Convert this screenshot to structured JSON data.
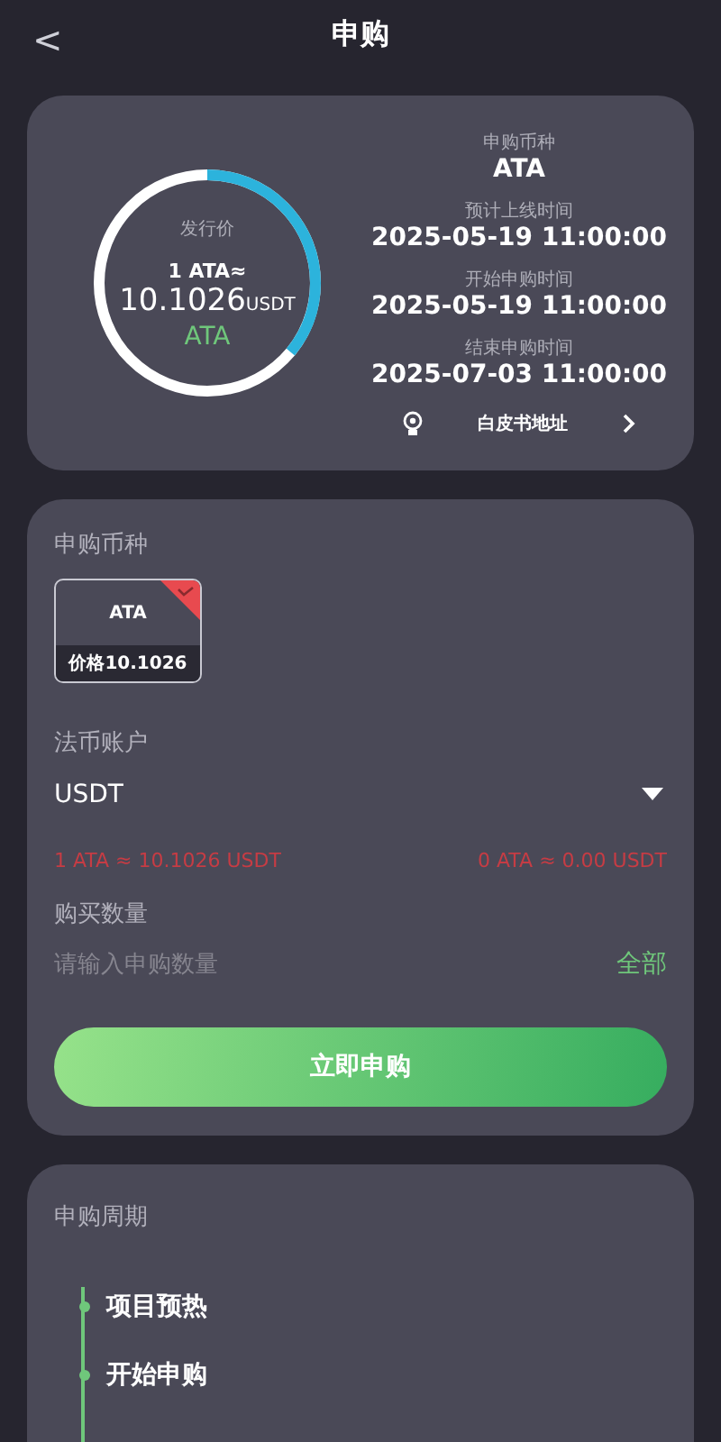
{
  "header": {
    "back": "<",
    "title": "申购"
  },
  "overview": {
    "ring_label": "发行价",
    "rate_line": "1 ATA≈",
    "price": "10.1026",
    "price_unit": "USDT",
    "coin": "ATA",
    "level": 0.36,
    "info": [
      {
        "label": "申购币种",
        "value": "ATA"
      },
      {
        "label": "预计上线时间",
        "value": "2025-05-19 11:00:00"
      },
      {
        "label": "开始申购时间",
        "value": "2025-05-19 11:00:00"
      },
      {
        "label": "结束申购时间",
        "value": "2025-07-03 11:00:00"
      }
    ],
    "whitepaper": "白皮书地址"
  },
  "form": {
    "coin_label": "申购币种",
    "coins": [
      {
        "name": "ATA",
        "price": "价格10.1026",
        "selected": true
      }
    ],
    "account_label": "法币账户",
    "account": "USDT",
    "rate_left": "1 ATA ≈ 10.1026 USDT",
    "rate_right": "0 ATA ≈ 0.00 USDT",
    "qty_label": "购买数量",
    "qty_placeholder": "请输入申购数量",
    "all": "全部",
    "submit": "立即申购"
  },
  "cycle": {
    "title": "申购周期",
    "steps": [
      {
        "label": "项目预热"
      },
      {
        "label": "开始申购"
      }
    ]
  }
}
